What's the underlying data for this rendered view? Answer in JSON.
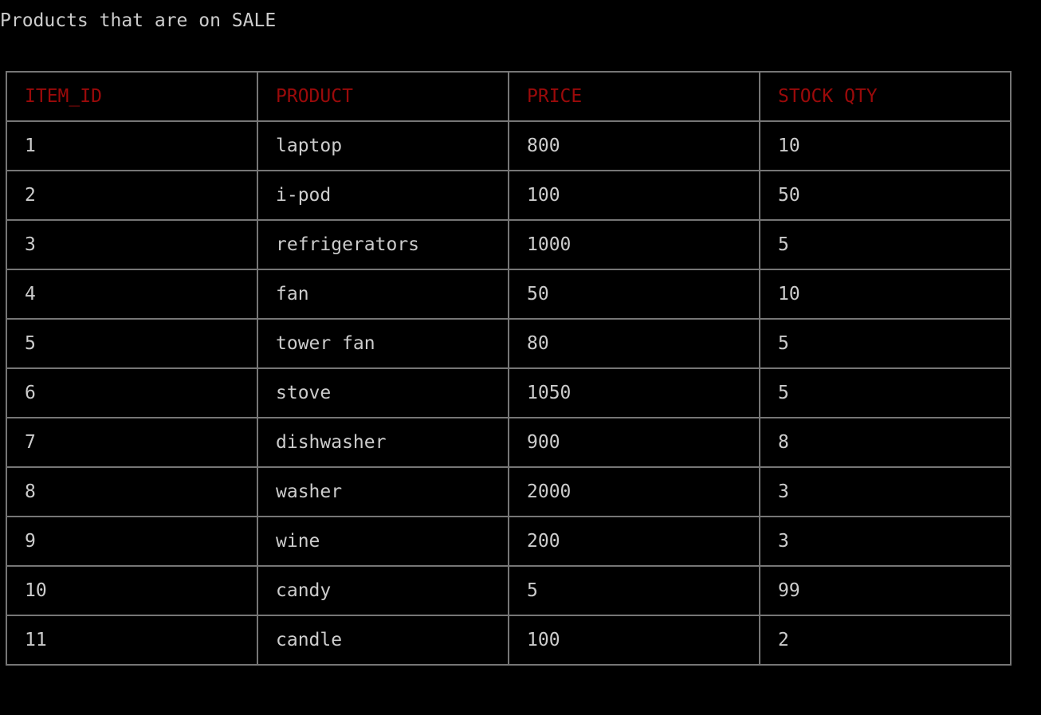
{
  "page": {
    "title": "Products that are on SALE"
  },
  "colors": {
    "background": "#000000",
    "text": "#cccccc",
    "header_text": "#9b0a0a",
    "border": "#767676"
  },
  "table": {
    "headers": [
      "ITEM_ID",
      "PRODUCT",
      "PRICE",
      "STOCK QTY"
    ],
    "rows": [
      [
        "1",
        "laptop",
        "800",
        "10"
      ],
      [
        "2",
        "i-pod",
        "100",
        "50"
      ],
      [
        "3",
        "refrigerators",
        "1000",
        "5"
      ],
      [
        "4",
        "fan",
        "50",
        "10"
      ],
      [
        "5",
        "tower fan",
        "80",
        "5"
      ],
      [
        "6",
        "stove",
        "1050",
        "5"
      ],
      [
        "7",
        "dishwasher",
        "900",
        "8"
      ],
      [
        "8",
        "washer",
        "2000",
        "3"
      ],
      [
        "9",
        "wine",
        "200",
        "3"
      ],
      [
        "10",
        "candy",
        "5",
        "99"
      ],
      [
        "11",
        "candle",
        "100",
        "2"
      ]
    ]
  }
}
